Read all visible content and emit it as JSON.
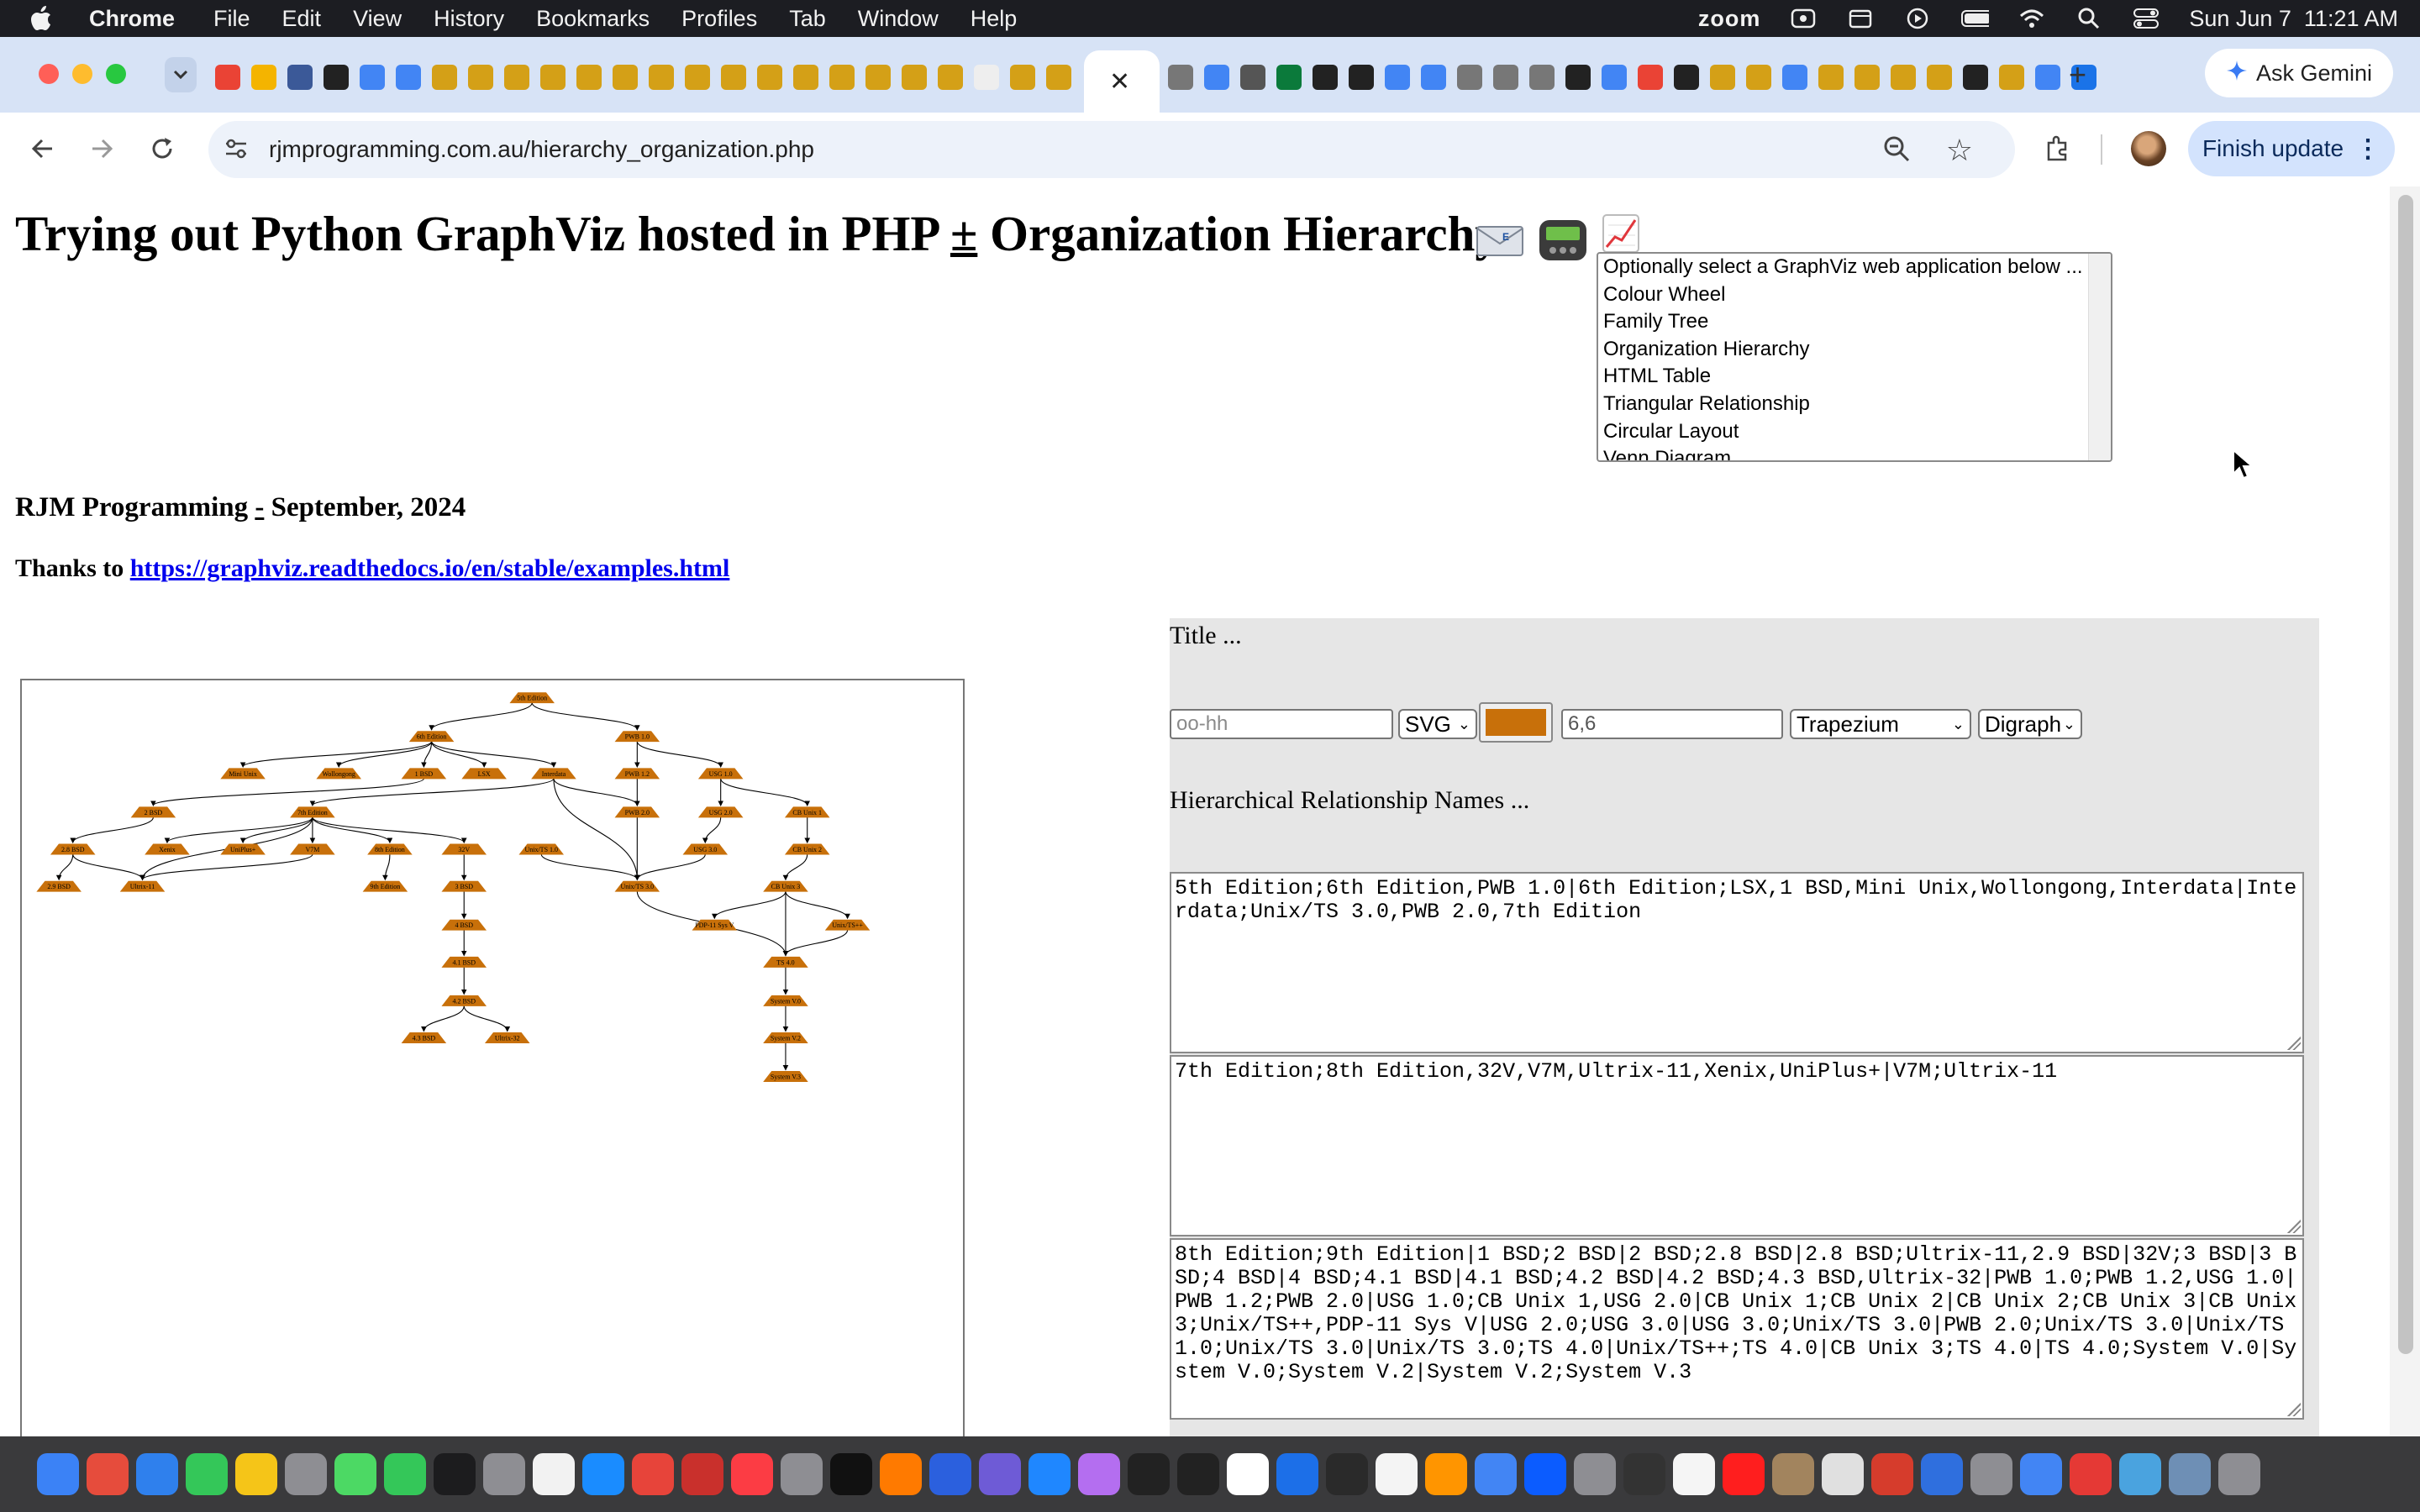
{
  "menubar": {
    "app": "Chrome",
    "items": [
      "File",
      "Edit",
      "View",
      "History",
      "Bookmarks",
      "Profiles",
      "Tab",
      "Window",
      "Help"
    ],
    "zoom": "zoom",
    "datetime": "Sun Jun 7  11:21 AM"
  },
  "browser": {
    "ask_gemini": "Ask Gemini",
    "url": "rjmprogramming.com.au/hierarchy_organization.php",
    "finish_update": "Finish update"
  },
  "page": {
    "title_part1": "Trying out Python GraphViz hosted in PHP ",
    "title_plusminus": "±",
    "title_part2": " Organization Hierarchy",
    "app_options": [
      "Optionally select a GraphViz web application below ...",
      "Colour Wheel",
      "Family Tree",
      "Organization Hierarchy",
      "HTML Table",
      "Triangular Relationship",
      "Circular Layout",
      "Venn Diagram"
    ],
    "byline_part1": "RJM Programming ",
    "byline_dash": "-",
    "byline_part2": " September, 2024",
    "thanks_label": "Thanks to ",
    "thanks_link": "https://graphviz.readthedocs.io/en/stable/examples.html"
  },
  "form": {
    "title_label": "Title ...",
    "name_placeholder": "oo-hh",
    "format": "SVG",
    "node_color": "#c8700a",
    "size_value": "6,6",
    "shape": "Trapezium",
    "graph_type": "Digraph",
    "hier_label": "Hierarchical Relationship Names ...",
    "ta1": "5th Edition;6th Edition,PWB 1.0|6th Edition;LSX,1 BSD,Mini Unix,Wollongong,Interdata|Interdata;Unix/TS 3.0,PWB 2.0,7th Edition",
    "ta2": "7th Edition;8th Edition,32V,V7M,Ultrix-11,Xenix,UniPlus+|V7M;Ultrix-11",
    "ta3": "8th Edition;9th Edition|1 BSD;2 BSD|2 BSD;2.8 BSD|2.8 BSD;Ultrix-11,2.9 BSD|32V;3 BSD|3 BSD;4 BSD|4 BSD;4.1 BSD|4.1 BSD;4.2 BSD|4.2 BSD;4.3 BSD,Ultrix-32|PWB 1.0;PWB 1.2,USG 1.0|PWB 1.2;PWB 2.0|USG 1.0;CB Unix 1,USG 2.0|CB Unix 1;CB Unix 2|CB Unix 2;CB Unix 3|CB Unix 3;Unix/TS++,PDP-11 Sys V|USG 2.0;USG 3.0|USG 3.0;Unix/TS 3.0|PWB 2.0;Unix/TS 3.0|Unix/TS 1.0;Unix/TS 3.0|Unix/TS 3.0;TS 4.0|Unix/TS++;TS 4.0|CB Unix 3;TS 4.0|TS 4.0;System V.0|System V.0;System V.2|System V.2;System V.3"
  },
  "graph": {
    "nodes": [
      {
        "id": "n5",
        "label": "5th Edition"
      },
      {
        "id": "n6",
        "label": "6th Edition"
      },
      {
        "id": "pwb10",
        "label": "PWB 1.0"
      },
      {
        "id": "mini",
        "label": "Mini Unix"
      },
      {
        "id": "woll",
        "label": "Wollongong"
      },
      {
        "id": "bsd1",
        "label": "1 BSD"
      },
      {
        "id": "lsx",
        "label": "LSX"
      },
      {
        "id": "inter",
        "label": "Interdata"
      },
      {
        "id": "pwb12",
        "label": "PWB 1.2"
      },
      {
        "id": "usg10",
        "label": "USG 1.0"
      },
      {
        "id": "bsd2",
        "label": "2 BSD"
      },
      {
        "id": "n7",
        "label": "7th Edition"
      },
      {
        "id": "pwb20",
        "label": "PWB 2.0"
      },
      {
        "id": "usg20",
        "label": "USG 2.0"
      },
      {
        "id": "cb1",
        "label": "CB Unix 1"
      },
      {
        "id": "bsd28",
        "label": "2.8 BSD"
      },
      {
        "id": "xenix",
        "label": "Xenix"
      },
      {
        "id": "uniplus",
        "label": "UniPlus+"
      },
      {
        "id": "v7m",
        "label": "V7M"
      },
      {
        "id": "n8",
        "label": "8th Edition"
      },
      {
        "id": "v32",
        "label": "32V"
      },
      {
        "id": "ts10",
        "label": "Unix/TS 1.0"
      },
      {
        "id": "usg30",
        "label": "USG 3.0"
      },
      {
        "id": "cb2",
        "label": "CB Unix 2"
      },
      {
        "id": "bsd29",
        "label": "2.9 BSD"
      },
      {
        "id": "ultrix11",
        "label": "Ultrix-11"
      },
      {
        "id": "n9",
        "label": "9th Edition"
      },
      {
        "id": "bsd3",
        "label": "3 BSD"
      },
      {
        "id": "ts30",
        "label": "Unix/TS 3.0"
      },
      {
        "id": "cb3",
        "label": "CB Unix 3"
      },
      {
        "id": "bsd4",
        "label": "4 BSD"
      },
      {
        "id": "pdp11",
        "label": "PDP-11 Sys V"
      },
      {
        "id": "tspp",
        "label": "Unix/TS++"
      },
      {
        "id": "bsd41",
        "label": "4.1 BSD"
      },
      {
        "id": "ts40",
        "label": "TS 4.0"
      },
      {
        "id": "bsd42",
        "label": "4.2 BSD"
      },
      {
        "id": "sv0",
        "label": "System V.0"
      },
      {
        "id": "bsd43",
        "label": "4.3 BSD"
      },
      {
        "id": "ultrix32",
        "label": "Ultrix-32"
      },
      {
        "id": "sv2",
        "label": "System V.2"
      },
      {
        "id": "sv3",
        "label": "System V.3"
      }
    ],
    "edges": [
      [
        "n5",
        "n6"
      ],
      [
        "n5",
        "pwb10"
      ],
      [
        "n6",
        "lsx"
      ],
      [
        "n6",
        "bsd1"
      ],
      [
        "n6",
        "mini"
      ],
      [
        "n6",
        "woll"
      ],
      [
        "n6",
        "inter"
      ],
      [
        "inter",
        "ts30"
      ],
      [
        "inter",
        "pwb20"
      ],
      [
        "inter",
        "n7"
      ],
      [
        "n7",
        "n8"
      ],
      [
        "n7",
        "v32"
      ],
      [
        "n7",
        "v7m"
      ],
      [
        "n7",
        "ultrix11"
      ],
      [
        "n7",
        "xenix"
      ],
      [
        "n7",
        "uniplus"
      ],
      [
        "v7m",
        "ultrix11"
      ],
      [
        "n8",
        "n9"
      ],
      [
        "bsd1",
        "bsd2"
      ],
      [
        "bsd2",
        "bsd28"
      ],
      [
        "bsd28",
        "ultrix11"
      ],
      [
        "bsd28",
        "bsd29"
      ],
      [
        "v32",
        "bsd3"
      ],
      [
        "bsd3",
        "bsd4"
      ],
      [
        "bsd4",
        "bsd41"
      ],
      [
        "bsd41",
        "bsd42"
      ],
      [
        "bsd42",
        "bsd43"
      ],
      [
        "bsd42",
        "ultrix32"
      ],
      [
        "pwb10",
        "pwb12"
      ],
      [
        "pwb10",
        "usg10"
      ],
      [
        "pwb12",
        "pwb20"
      ],
      [
        "usg10",
        "cb1"
      ],
      [
        "usg10",
        "usg20"
      ],
      [
        "cb1",
        "cb2"
      ],
      [
        "cb2",
        "cb3"
      ],
      [
        "cb3",
        "tspp"
      ],
      [
        "cb3",
        "pdp11"
      ],
      [
        "usg20",
        "usg30"
      ],
      [
        "usg30",
        "ts30"
      ],
      [
        "pwb20",
        "ts30"
      ],
      [
        "ts10",
        "ts30"
      ],
      [
        "ts30",
        "ts40"
      ],
      [
        "tspp",
        "ts40"
      ],
      [
        "cb3",
        "ts40"
      ],
      [
        "ts40",
        "sv0"
      ],
      [
        "sv0",
        "sv2"
      ],
      [
        "sv2",
        "sv3"
      ]
    ]
  }
}
